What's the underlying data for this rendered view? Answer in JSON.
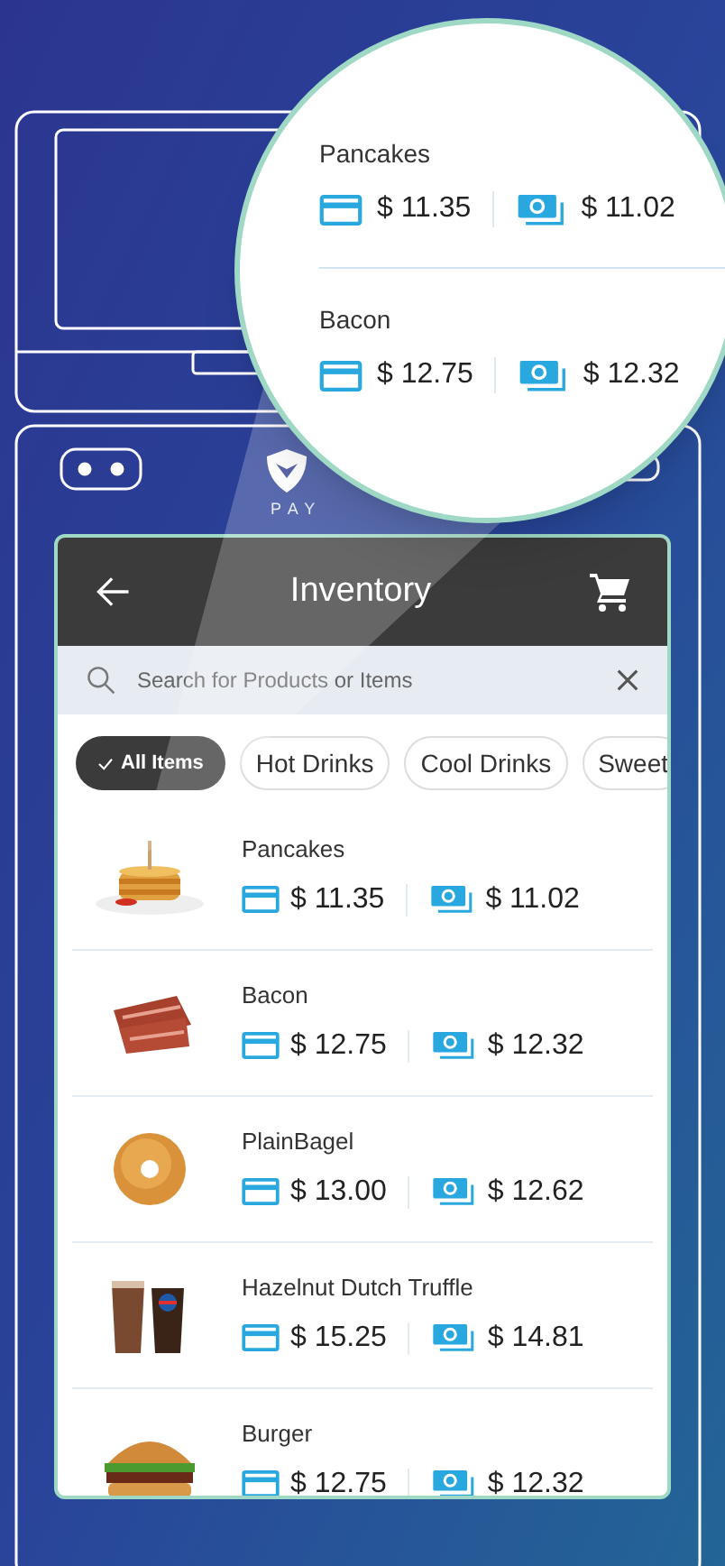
{
  "magnifier": {
    "items": [
      {
        "name": "Pancakes",
        "card_price": "$ 11.35",
        "cash_price": "$ 11.02"
      },
      {
        "name": "Bacon",
        "card_price": "$ 12.75",
        "cash_price": "$ 12.32"
      }
    ]
  },
  "logo": {
    "text": "PAY"
  },
  "app": {
    "title": "Inventory",
    "search": {
      "placeholder": "Search for Products or Items"
    },
    "chips": [
      {
        "label": "All Items",
        "selected": true
      },
      {
        "label": "Hot Drinks",
        "selected": false
      },
      {
        "label": "Cool Drinks",
        "selected": false
      },
      {
        "label": "Sweet",
        "selected": false
      }
    ],
    "items": [
      {
        "name": "Pancakes",
        "card_price": "$ 11.35",
        "cash_price": "$ 11.02"
      },
      {
        "name": "Bacon",
        "card_price": "$ 12.75",
        "cash_price": "$ 12.32"
      },
      {
        "name": "PlainBagel",
        "card_price": "$ 13.00",
        "cash_price": "$ 12.62"
      },
      {
        "name": "Hazelnut Dutch Truffle",
        "card_price": "$ 15.25",
        "cash_price": "$ 14.81"
      },
      {
        "name": "Burger",
        "card_price": "$ 12.75",
        "cash_price": "$ 12.32"
      }
    ]
  }
}
